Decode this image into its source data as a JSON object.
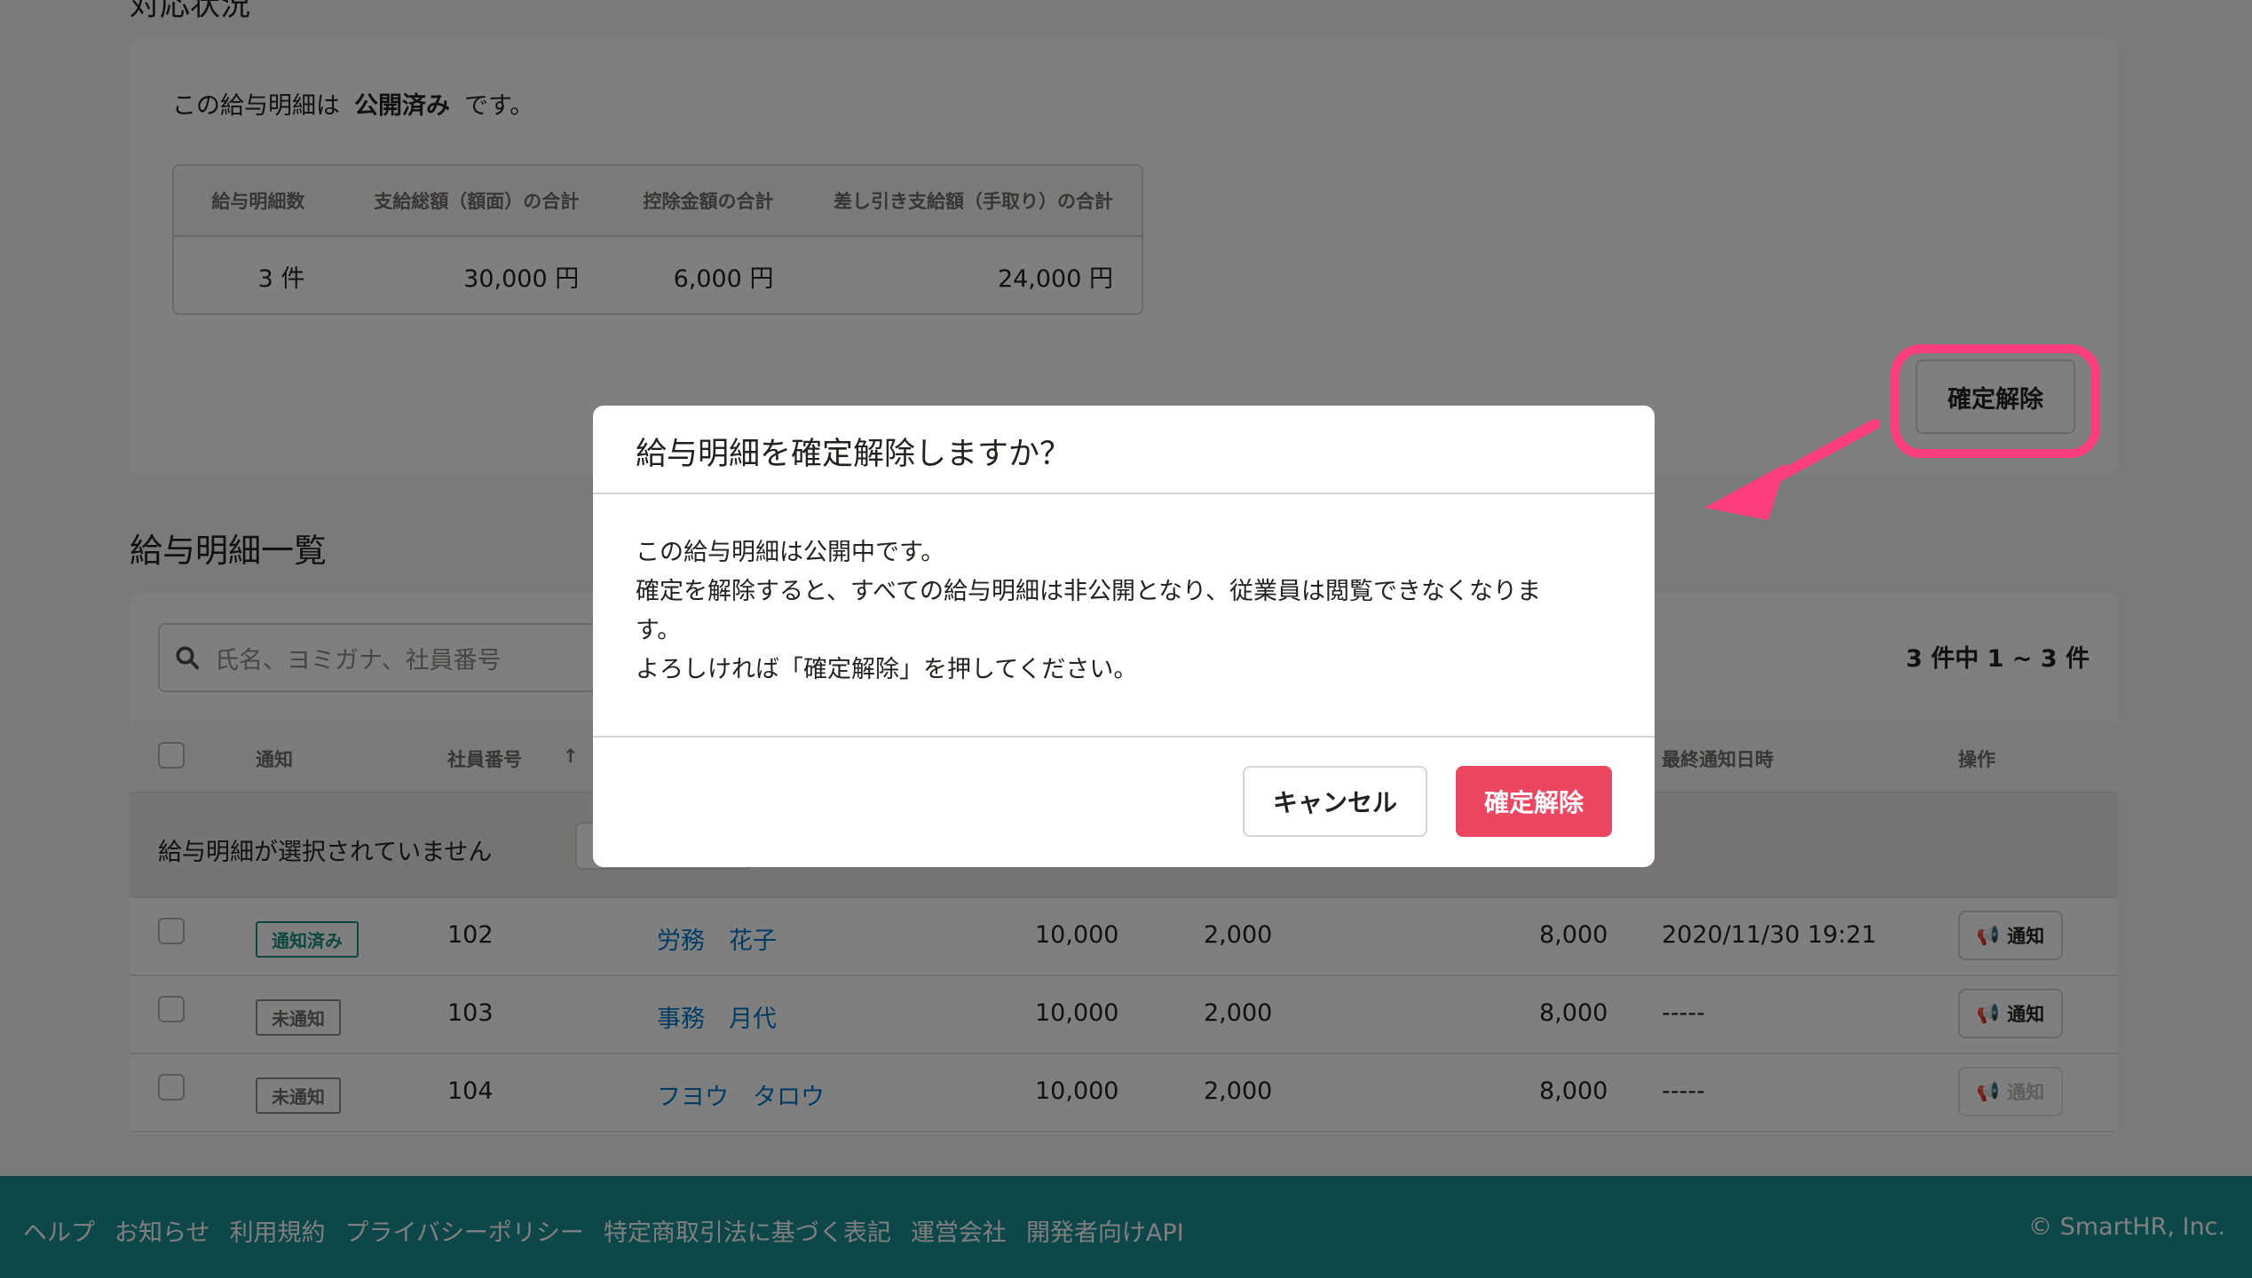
{
  "status_section": {
    "heading": "対応状況",
    "text_prefix": "この給与明細は",
    "text_status": "公開済み",
    "text_suffix": "です。",
    "summary_headers": [
      "給与明細数",
      "支給総額（額面）の合計",
      "控除金額の合計",
      "差し引き支給額（手取り）の合計"
    ],
    "summary_values": [
      "3 件",
      "30,000 円",
      "6,000 円",
      "24,000 円"
    ],
    "unpublish_button": "確定解除"
  },
  "list_section": {
    "heading": "給与明細一覧",
    "search_placeholder": "氏名、ヨミガナ、社員番号",
    "count_text": "3 件中 1 ~ 3 件",
    "columns": {
      "notify": "通知",
      "employee_no": "社員番号",
      "last_notified": "最終通知日時",
      "action": "操作"
    },
    "sort_indicator": "↑",
    "bulk_text": "給与明細が選択されていません",
    "rows": [
      {
        "status": "通知済み",
        "no": "102",
        "name": "労務　花子",
        "gross": "10,000",
        "deduction": "2,000",
        "net": "8,000",
        "date": "2020/11/30 19:21",
        "action": "通知",
        "disabled": false
      },
      {
        "status": "未通知",
        "no": "103",
        "name": "事務　月代",
        "gross": "10,000",
        "deduction": "2,000",
        "net": "8,000",
        "date": "-----",
        "action": "通知",
        "disabled": false
      },
      {
        "status": "未通知",
        "no": "104",
        "name": "フヨウ　タロウ",
        "gross": "10,000",
        "deduction": "2,000",
        "net": "8,000",
        "date": "-----",
        "action": "通知",
        "disabled": true
      }
    ]
  },
  "dialog": {
    "title": "給与明細を確定解除しますか？",
    "body_line1": "この給与明細は公開中です。",
    "body_line2": "確定を解除すると、すべての給与明細は非公開となり、従業員は閲覧できなくなりま",
    "body_line3": "す。",
    "body_line4": "よろしければ「確定解除」を押してください。",
    "cancel_label": "キャンセル",
    "confirm_label": "確定解除"
  },
  "footer": {
    "links": [
      "ヘルプ",
      "お知らせ",
      "利用規約",
      "プライバシーポリシー",
      "特定商取引法に基づく表記",
      "運営会社",
      "開発者向けAPI"
    ],
    "copyright": "© SmartHR, Inc."
  },
  "colors": {
    "highlight": "#ff3d7f",
    "confirm": "#ec4762",
    "footer": "#1a8f95",
    "link": "#0077c7"
  }
}
